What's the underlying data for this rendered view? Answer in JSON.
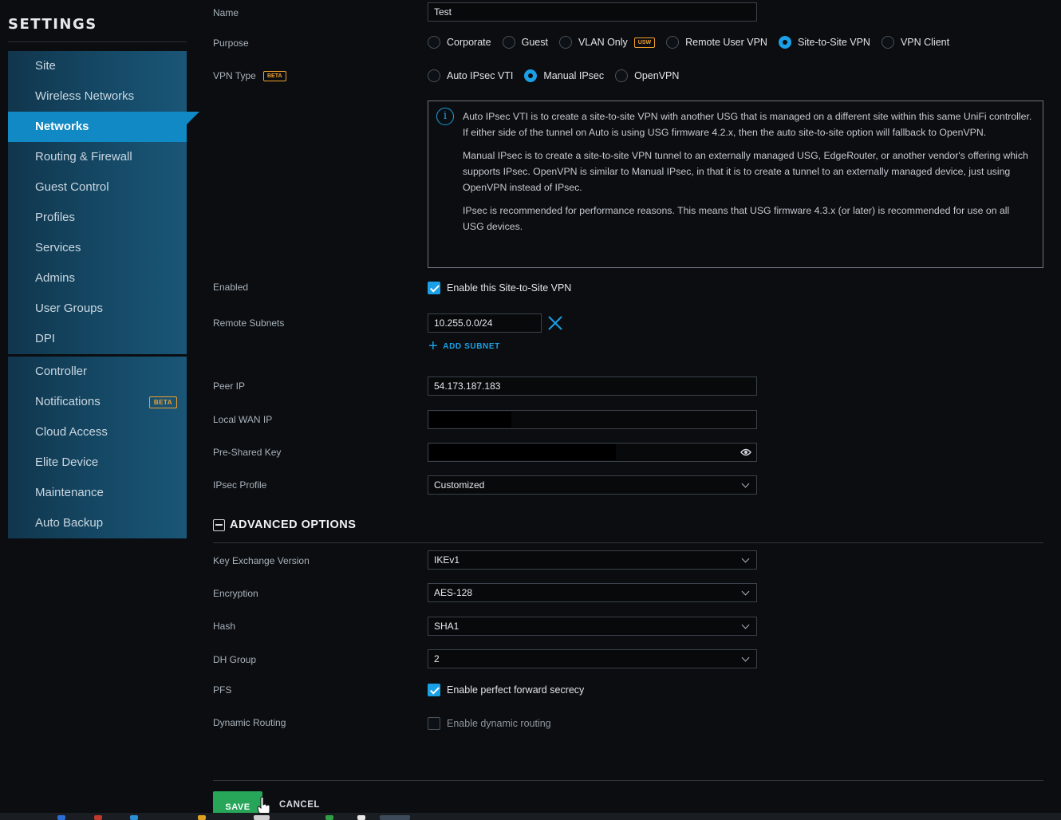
{
  "sidebar": {
    "title": "SETTINGS",
    "group1": [
      {
        "label": "Site"
      },
      {
        "label": "Wireless Networks"
      },
      {
        "label": "Networks",
        "active": true
      },
      {
        "label": "Routing & Firewall"
      },
      {
        "label": "Guest Control"
      },
      {
        "label": "Profiles"
      },
      {
        "label": "Services"
      },
      {
        "label": "Admins"
      },
      {
        "label": "User Groups"
      },
      {
        "label": "DPI"
      }
    ],
    "group2": [
      {
        "label": "Controller"
      },
      {
        "label": "Notifications",
        "badge": "BETA"
      },
      {
        "label": "Cloud Access"
      },
      {
        "label": "Elite Device"
      },
      {
        "label": "Maintenance"
      },
      {
        "label": "Auto Backup"
      }
    ]
  },
  "form": {
    "name": {
      "label": "Name",
      "value": "Test"
    },
    "purpose": {
      "label": "Purpose",
      "options": [
        "Corporate",
        "Guest",
        "VLAN Only",
        "Remote User VPN",
        "Site-to-Site VPN",
        "VPN Client"
      ],
      "vlan_badge": "USW",
      "selected": "Site-to-Site VPN"
    },
    "vpn_type": {
      "label": "VPN Type",
      "badge": "BETA",
      "options": [
        "Auto IPsec VTI",
        "Manual IPsec",
        "OpenVPN"
      ],
      "selected": "Manual IPsec"
    },
    "info": {
      "p1": "Auto IPsec VTI is to create a site-to-site VPN with another USG that is managed on a different site within this same UniFi controller. If either side of the tunnel on Auto is using USG firmware 4.2.x, then the auto site-to-site option will fallback to OpenVPN.",
      "p2": "Manual IPsec is to create a site-to-site VPN tunnel to an externally managed USG, EdgeRouter, or another vendor's offering which supports IPsec. OpenVPN is similar to Manual IPsec, in that it is to create a tunnel to an externally managed device, just using OpenVPN instead of IPsec.",
      "p3": "IPsec is recommended for performance reasons. This means that USG firmware 4.3.x (or later) is recommended for use on all USG devices."
    },
    "enabled": {
      "label": "Enabled",
      "checkbox": "Enable this Site-to-Site VPN",
      "checked": true
    },
    "remote_subnets": {
      "label": "Remote Subnets",
      "value": "10.255.0.0/24",
      "add": "ADD SUBNET"
    },
    "peer_ip": {
      "label": "Peer IP",
      "value": "54.173.187.183"
    },
    "local_wan_ip": {
      "label": "Local WAN IP",
      "value": ""
    },
    "psk": {
      "label": "Pre-Shared Key",
      "value": ""
    },
    "ipsec_profile": {
      "label": "IPsec Profile",
      "value": "Customized"
    },
    "advanced": {
      "title": "ADVANCED OPTIONS",
      "key_exchange": {
        "label": "Key Exchange Version",
        "value": "IKEv1"
      },
      "encryption": {
        "label": "Encryption",
        "value": "AES-128"
      },
      "hash": {
        "label": "Hash",
        "value": "SHA1"
      },
      "dh_group": {
        "label": "DH Group",
        "value": "2"
      },
      "pfs": {
        "label": "PFS",
        "checkbox": "Enable perfect forward secrecy",
        "checked": true
      },
      "dynamic_routing": {
        "label": "Dynamic Routing",
        "checkbox": "Enable dynamic routing",
        "checked": false
      }
    }
  },
  "actions": {
    "save": "SAVE",
    "cancel": "CANCEL"
  },
  "colors": {
    "accent": "#1aa0e6",
    "active_nav": "#1189c4",
    "save": "#27a65a",
    "badge": "#f0a030"
  }
}
